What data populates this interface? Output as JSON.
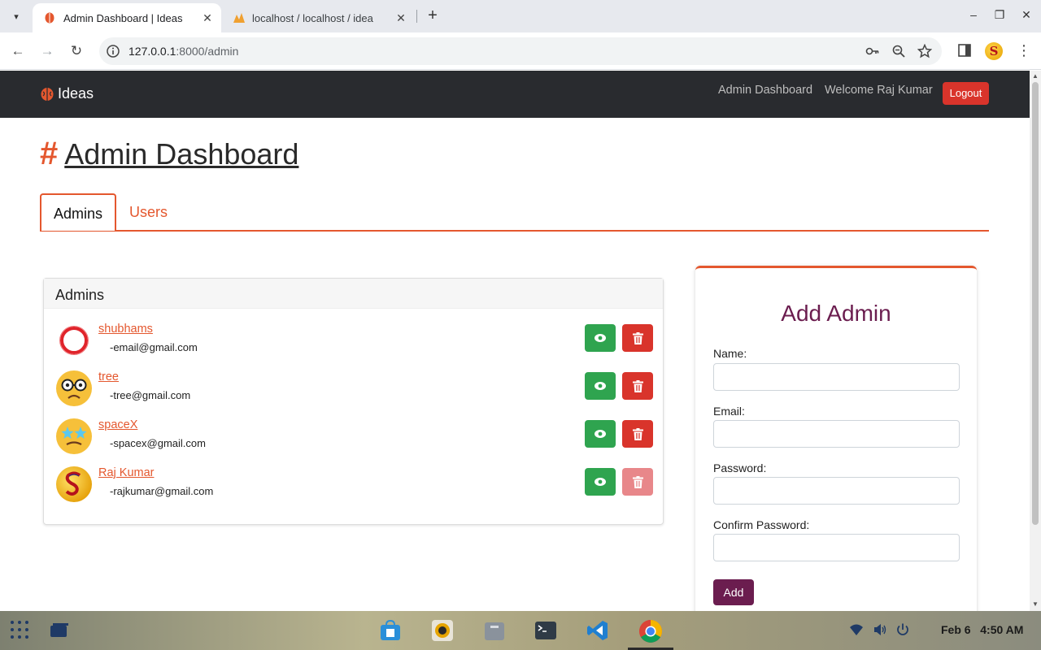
{
  "browser": {
    "tabs": [
      {
        "title": "Admin Dashboard | Ideas",
        "active": true
      },
      {
        "title": "localhost / localhost / idea",
        "active": false
      }
    ],
    "url_host": "127.0.0.1",
    "url_path": ":8000/admin"
  },
  "navbar": {
    "brand": "Ideas",
    "links": [
      "Admin Dashboard",
      "Welcome Raj Kumar"
    ],
    "logout_label": "Logout"
  },
  "page": {
    "title_hash": "#",
    "title": "Admin Dashboard",
    "tabs": [
      {
        "label": "Admins",
        "active": true
      },
      {
        "label": "Users",
        "active": false
      }
    ]
  },
  "admins_card": {
    "header": "Admins",
    "rows": [
      {
        "name": "shubhams",
        "email": "-email@gmail.com",
        "avatar": "red-ring-icon",
        "delete_disabled": false
      },
      {
        "name": "tree",
        "email": "-tree@gmail.com",
        "avatar": "nerd-face-icon",
        "delete_disabled": false
      },
      {
        "name": "spaceX",
        "email": "-spacex@gmail.com",
        "avatar": "star-struck-face-icon",
        "delete_disabled": false
      },
      {
        "name": "Raj Kumar",
        "email": "-rajkumar@gmail.com",
        "avatar": "letter-s-avatar-icon",
        "delete_disabled": true
      }
    ]
  },
  "add_admin_form": {
    "title": "Add Admin",
    "fields": [
      {
        "label": "Name:",
        "value": ""
      },
      {
        "label": "Email:",
        "value": ""
      },
      {
        "label": "Password:",
        "value": ""
      },
      {
        "label": "Confirm Password:",
        "value": ""
      }
    ],
    "submit_label": "Add"
  },
  "taskbar": {
    "date": "Feb 6",
    "time": "4:50 AM"
  },
  "colors": {
    "accent": "#e4572e",
    "navbar_bg": "#292b2f",
    "danger": "#d9342b",
    "success": "#2fa44f",
    "form_primary": "#6b1d4f"
  }
}
